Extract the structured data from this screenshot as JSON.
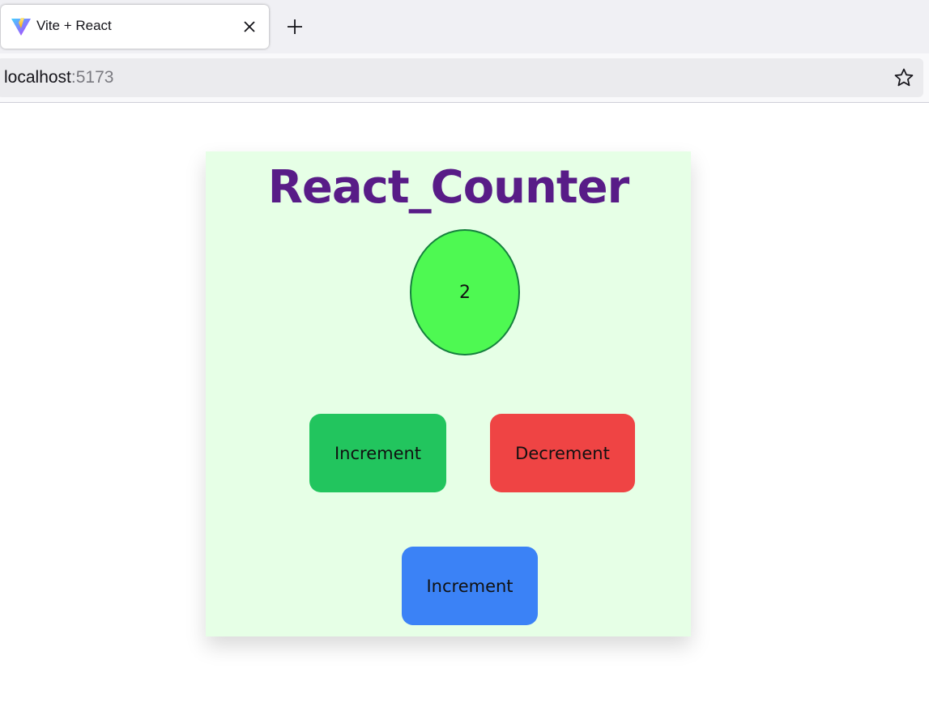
{
  "browser": {
    "tab": {
      "title": "Vite + React",
      "favicon": "vite-logo-icon"
    },
    "address_bar": {
      "host": "localhost",
      "port": ":5173"
    }
  },
  "app": {
    "title": "React_Counter",
    "counter_value": "2",
    "buttons": {
      "increment_label": "Increment",
      "decrement_label": "Decrement",
      "increment_blue_label": "Increment"
    },
    "colors": {
      "title": "#581c87",
      "card_background": "#e6ffe6",
      "counter_fill": "#4ef952",
      "counter_border": "#15803d",
      "increment": "#22c55e",
      "decrement": "#ef4444",
      "increment_blue": "#3b82f6"
    }
  }
}
